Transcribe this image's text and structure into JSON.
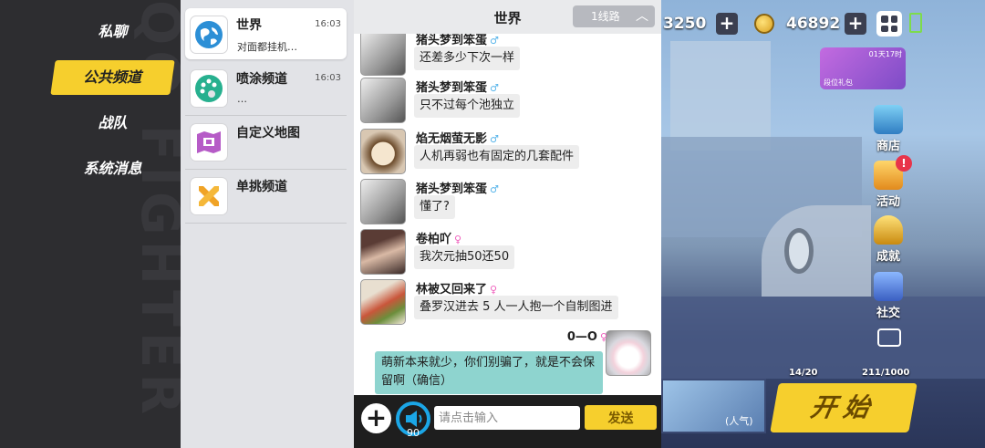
{
  "left_nav": {
    "items": [
      {
        "label": "私聊",
        "active": false
      },
      {
        "label": "公共频道",
        "active": true
      },
      {
        "label": "战队",
        "active": false
      },
      {
        "label": "系统消息",
        "active": false
      }
    ]
  },
  "channels": [
    {
      "name": "世界",
      "time": "16:03",
      "preview": "对面都挂机…",
      "icon": "globe-icon",
      "selected": true
    },
    {
      "name": "喷涂频道",
      "time": "16:03",
      "preview": "…",
      "icon": "palette-icon",
      "selected": false
    },
    {
      "name": "自定义地图",
      "time": "",
      "preview": "",
      "icon": "map-icon",
      "selected": false
    },
    {
      "name": "单挑频道",
      "time": "",
      "preview": "",
      "icon": "crossed-swords-icon",
      "selected": false
    }
  ],
  "chat": {
    "title": "世界",
    "line_selector": "1线路",
    "messages": [
      {
        "user": "猪头梦到笨蛋",
        "gender": "♂",
        "text": "还差多少下次一样",
        "mine": false
      },
      {
        "user": "猪头梦到笨蛋",
        "gender": "♂",
        "text": "只不过每个池独立",
        "mine": false
      },
      {
        "user": "焰无烟萤无影",
        "gender": "♂",
        "text": "人机再弱也有固定的几套配件",
        "mine": false
      },
      {
        "user": "猪头梦到笨蛋",
        "gender": "♂",
        "text": "懂了?",
        "mine": false
      },
      {
        "user": "卷柏吖",
        "gender": "♀",
        "text": "我次元抽50还50",
        "mine": false
      },
      {
        "user": "林被又回来了",
        "gender": "♀",
        "text": "叠罗汉进去 5 人一人抱一个自制图进",
        "mine": false
      },
      {
        "user": "0—O",
        "gender": "♀",
        "text": "萌新本来就少，你们别骗了，就是不会保留啊（确信）",
        "mine": true
      }
    ],
    "input": {
      "placeholder": "请点击输入",
      "value": ""
    },
    "send_label": "发送",
    "speaker_count": "90"
  },
  "game_hud": {
    "currency_1": "3250",
    "currency_2": "46892",
    "event_timer": "01天17时",
    "event_label": "段位礼包",
    "side_buttons": [
      "商店",
      "活动",
      "成就",
      "社交"
    ],
    "stat_1": "14/20",
    "stat_2": "211/1000",
    "popularity": "(人气)",
    "start_label": "开始"
  },
  "colors": {
    "accent_yellow": "#f6cf2d",
    "my_bubble": "#8ed4cf",
    "male": "#59b5ea",
    "female": "#ef60bd",
    "speaker_ring": "#1ba6e6"
  }
}
